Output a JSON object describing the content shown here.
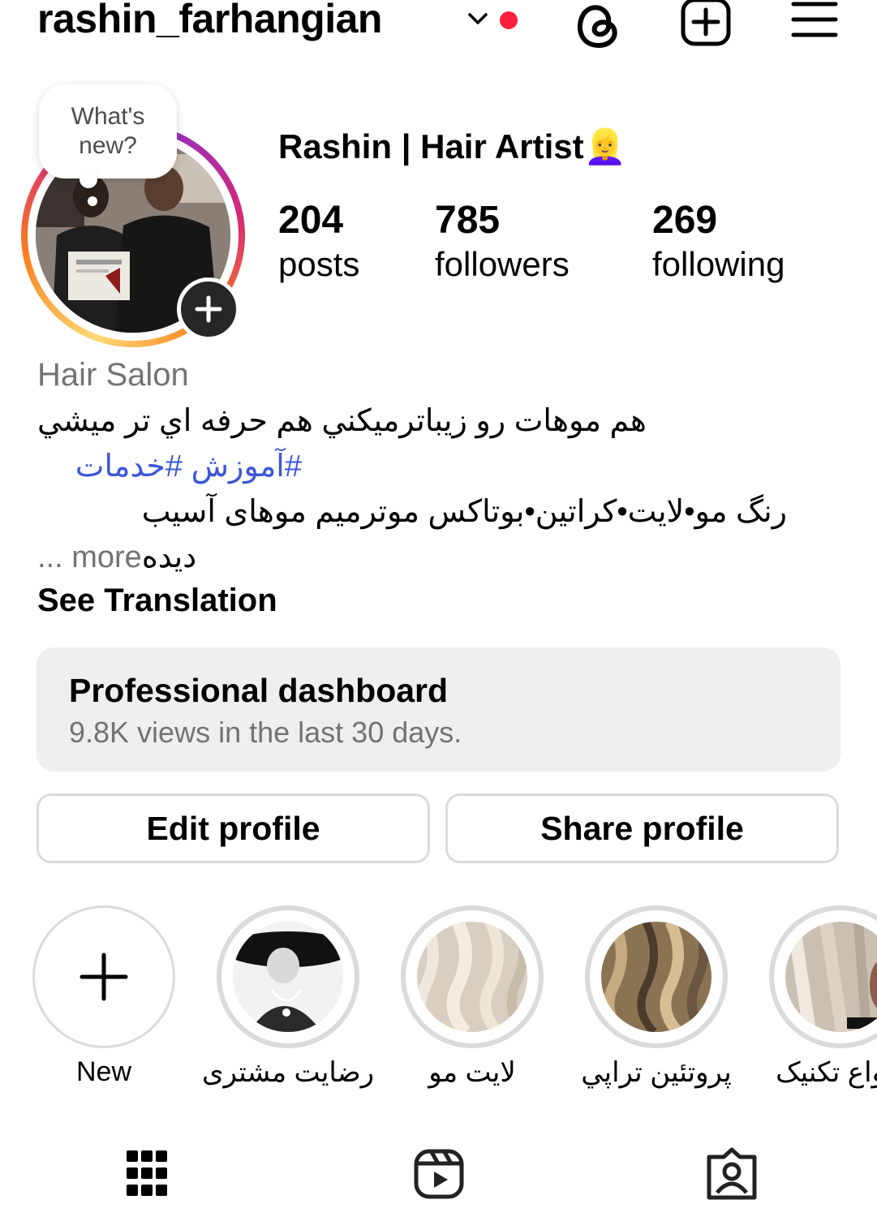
{
  "header": {
    "username": "rashin_farhangian"
  },
  "avatar": {
    "bubble_text": "What's\nnew?"
  },
  "profile": {
    "full_name": "Rashin | Hair Artist👱‍♀️",
    "stats": [
      {
        "value": "204",
        "label": "posts"
      },
      {
        "value": "785",
        "label": "followers"
      },
      {
        "value": "269",
        "label": "following"
      }
    ],
    "category": "Hair Salon",
    "bio_line1": "هم موهات رو زيباترميكني هم حرفه اي تر ميشي",
    "bio_hashtags": "#آموزش #خدمات",
    "bio_line3": "رنگ مو•لایت•کراتین•بوتاکس موترمیم موهای آسیب",
    "bio_line4": "دیده",
    "more_label": "... more",
    "see_translation": "See Translation"
  },
  "dashboard": {
    "title": "Professional dashboard",
    "subtitle": "9.8K views in the last 30 days."
  },
  "buttons": {
    "edit": "Edit profile",
    "share": "Share profile"
  },
  "highlights": [
    {
      "label": "New"
    },
    {
      "label": "رضایت مشتری"
    },
    {
      "label": "لایت مو"
    },
    {
      "label": "پروتئین تراپي"
    },
    {
      "label": "انواع تکنیک"
    }
  ],
  "icons": {
    "threads": "threads-icon",
    "create": "plus-square-icon",
    "menu": "hamburger-menu-icon",
    "grid": "grid-icon",
    "reels": "reels-icon",
    "tagged": "tagged-icon"
  },
  "colors": {
    "link": "#3c56d8",
    "notification_dot": "#ff1f3d",
    "secondary_text": "#737373"
  }
}
